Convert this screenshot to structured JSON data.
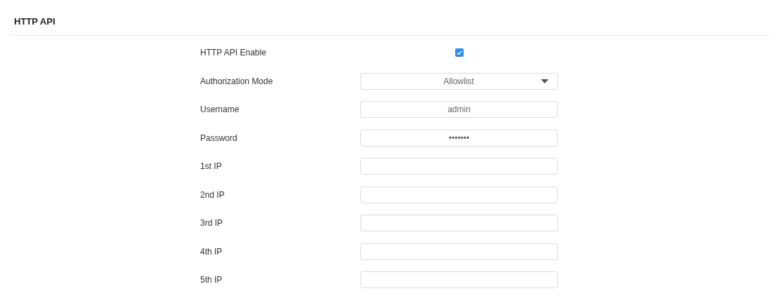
{
  "section_title": "HTTP API",
  "fields": [
    {
      "label": "HTTP API Enable",
      "kind": "checkbox",
      "checked": true
    },
    {
      "label": "Authorization Mode",
      "kind": "select",
      "value": "Allowlist"
    },
    {
      "label": "Username",
      "kind": "text",
      "value": "admin"
    },
    {
      "label": "Password",
      "kind": "text",
      "value": "•••••••"
    },
    {
      "label": "1st IP",
      "kind": "text"
    },
    {
      "label": "2nd IP",
      "kind": "text"
    },
    {
      "label": "3rd IP",
      "kind": "text"
    },
    {
      "label": "4th IP",
      "kind": "text"
    },
    {
      "label": "5th IP",
      "kind": "text"
    }
  ]
}
